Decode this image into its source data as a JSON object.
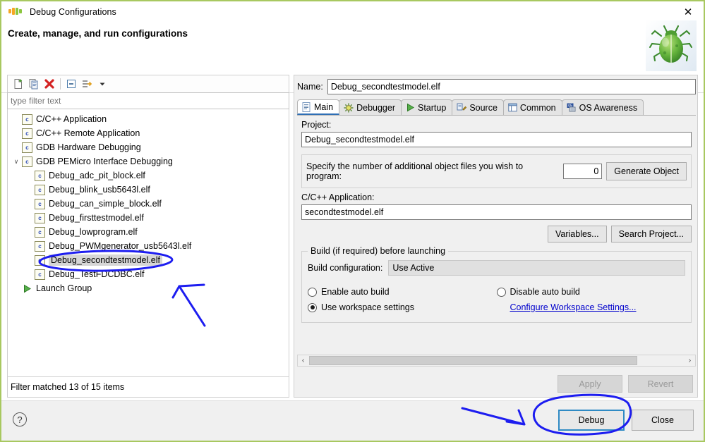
{
  "window": {
    "title": "Debug Configurations",
    "close_label": "✕",
    "logo_name": "nxp-logo",
    "border_color": "#a8c860"
  },
  "header": {
    "title": "Create, manage, and run configurations",
    "decoration_icon": "bug-icon"
  },
  "left_panel": {
    "toolbar": [
      {
        "name": "new-configuration-icon",
        "tooltip": "New launch configuration"
      },
      {
        "name": "duplicate-configuration-icon",
        "tooltip": "Duplicate"
      },
      {
        "name": "delete-configuration-icon",
        "tooltip": "Delete"
      },
      {
        "name": "collapse-all-icon",
        "tooltip": "Collapse All"
      },
      {
        "name": "filter-configurations-icon",
        "tooltip": "Filter launch configurations"
      },
      {
        "name": "chevron-down-icon",
        "tooltip": "View menu"
      }
    ],
    "filter": {
      "value": "",
      "placeholder": "type filter text"
    },
    "tree": [
      {
        "label": "C/C++ Application",
        "icon": "c-file-icon",
        "depth": 1,
        "expandable": false,
        "selected": false
      },
      {
        "label": "C/C++ Remote Application",
        "icon": "c-file-icon",
        "depth": 1,
        "expandable": false,
        "selected": false
      },
      {
        "label": "GDB Hardware Debugging",
        "icon": "c-file-icon",
        "depth": 1,
        "expandable": false,
        "selected": false
      },
      {
        "label": "GDB PEMicro Interface Debugging",
        "icon": "c-file-icon",
        "depth": 1,
        "expandable": true,
        "expanded": true,
        "selected": false
      },
      {
        "label": "Debug_adc_pit_block.elf",
        "icon": "c-file-icon",
        "depth": 2,
        "expandable": false,
        "selected": false
      },
      {
        "label": "Debug_blink_usb5643l.elf",
        "icon": "c-file-icon",
        "depth": 2,
        "expandable": false,
        "selected": false
      },
      {
        "label": "Debug_can_simple_block.elf",
        "icon": "c-file-icon",
        "depth": 2,
        "expandable": false,
        "selected": false
      },
      {
        "label": "Debug_firsttestmodel.elf",
        "icon": "c-file-icon",
        "depth": 2,
        "expandable": false,
        "selected": false
      },
      {
        "label": "Debug_lowprogram.elf",
        "icon": "c-file-icon",
        "depth": 2,
        "expandable": false,
        "selected": false
      },
      {
        "label": "Debug_PWMgenerator_usb5643l.elf",
        "icon": "c-file-icon",
        "depth": 2,
        "expandable": false,
        "selected": false
      },
      {
        "label": "Debug_secondtestmodel.elf",
        "icon": "c-file-icon",
        "depth": 2,
        "expandable": false,
        "selected": true
      },
      {
        "label": "Debug_TestFDCDBC.elf",
        "icon": "c-file-icon",
        "depth": 2,
        "expandable": false,
        "selected": false
      },
      {
        "label": "Launch Group",
        "icon": "launch-group-icon",
        "depth": 1,
        "expandable": false,
        "selected": false
      }
    ],
    "status": "Filter matched 13 of 15 items"
  },
  "right_panel": {
    "name_label": "Name:",
    "name_value": "Debug_secondtestmodel.elf",
    "tabs": [
      {
        "label": "Main",
        "icon": "document-icon",
        "active": true
      },
      {
        "label": "Debugger",
        "icon": "gear-icon",
        "active": false
      },
      {
        "label": "Startup",
        "icon": "play-icon",
        "active": false
      },
      {
        "label": "Source",
        "icon": "source-edit-icon",
        "active": false
      },
      {
        "label": "Common",
        "icon": "window-icon",
        "active": false
      },
      {
        "label": "OS Awareness",
        "icon": "os-awareness-icon",
        "active": false
      }
    ],
    "main_tab": {
      "project_label": "Project:",
      "project_value": "Debug_secondtestmodel.elf",
      "object_files_label": "Specify the number of additional object files you wish to program:",
      "object_files_value": "0",
      "generate_object_label": "Generate Object",
      "application_label": "C/C++ Application:",
      "application_value": "secondtestmodel.elf",
      "variables_label": "Variables...",
      "search_project_label": "Search Project...",
      "build_group_label": "Build (if required) before launching",
      "build_config_label": "Build configuration:",
      "build_config_value": "Use Active",
      "enable_auto_build_label": "Enable auto build",
      "disable_auto_build_label": "Disable auto build",
      "use_workspace_settings_label": "Use workspace settings",
      "configure_workspace_link": "Configure Workspace Settings...",
      "selected_radio": "use_workspace_settings",
      "scroll_left_arrow": "‹",
      "scroll_right_arrow": "›"
    },
    "apply_label": "Apply",
    "revert_label": "Revert",
    "apply_enabled": false,
    "revert_enabled": false
  },
  "footer": {
    "help_label": "?",
    "debug_label": "Debug",
    "close_label": "Close"
  },
  "annotations": {
    "color": "#1d1df0",
    "items": [
      {
        "name": "ellipse-around-selected-config",
        "shape": "ellipse"
      },
      {
        "name": "arrow-pointing-to-selected-config",
        "shape": "arrow"
      },
      {
        "name": "ellipse-around-debug-button",
        "shape": "ellipse"
      },
      {
        "name": "arrow-pointing-to-debug-button",
        "shape": "arrow"
      }
    ]
  }
}
